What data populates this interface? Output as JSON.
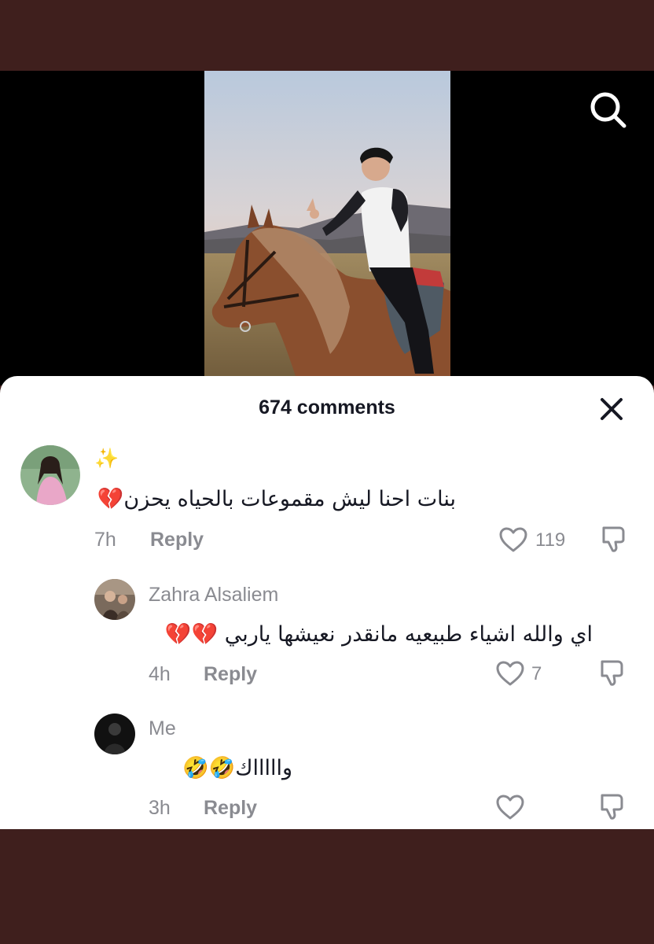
{
  "header": {
    "comments_count_label": "674 comments"
  },
  "icons": {
    "search": "search-icon",
    "close": "close-icon",
    "like": "heart-icon",
    "dislike": "thumbs-down-icon"
  },
  "comments": [
    {
      "username": "✨",
      "text": "بنات احنا ليش مقموعات بالحياه يحزن💔",
      "time": "7h",
      "reply_label": "Reply",
      "likes": "119"
    },
    {
      "username": "Zahra Alsaliem",
      "text": "اي والله اشياء طبيعيه مانقدر نعيشها ياربي 💔💔",
      "time": "4h",
      "reply_label": "Reply",
      "likes": "7"
    },
    {
      "username": "Me",
      "text": "واااااك🤣🤣",
      "time": "3h",
      "reply_label": "Reply",
      "likes": ""
    }
  ],
  "colors": {
    "background_band": "#3f1f1d",
    "sheet": "#ffffff",
    "primary_text": "#161823",
    "secondary_text": "#8a8b91"
  }
}
